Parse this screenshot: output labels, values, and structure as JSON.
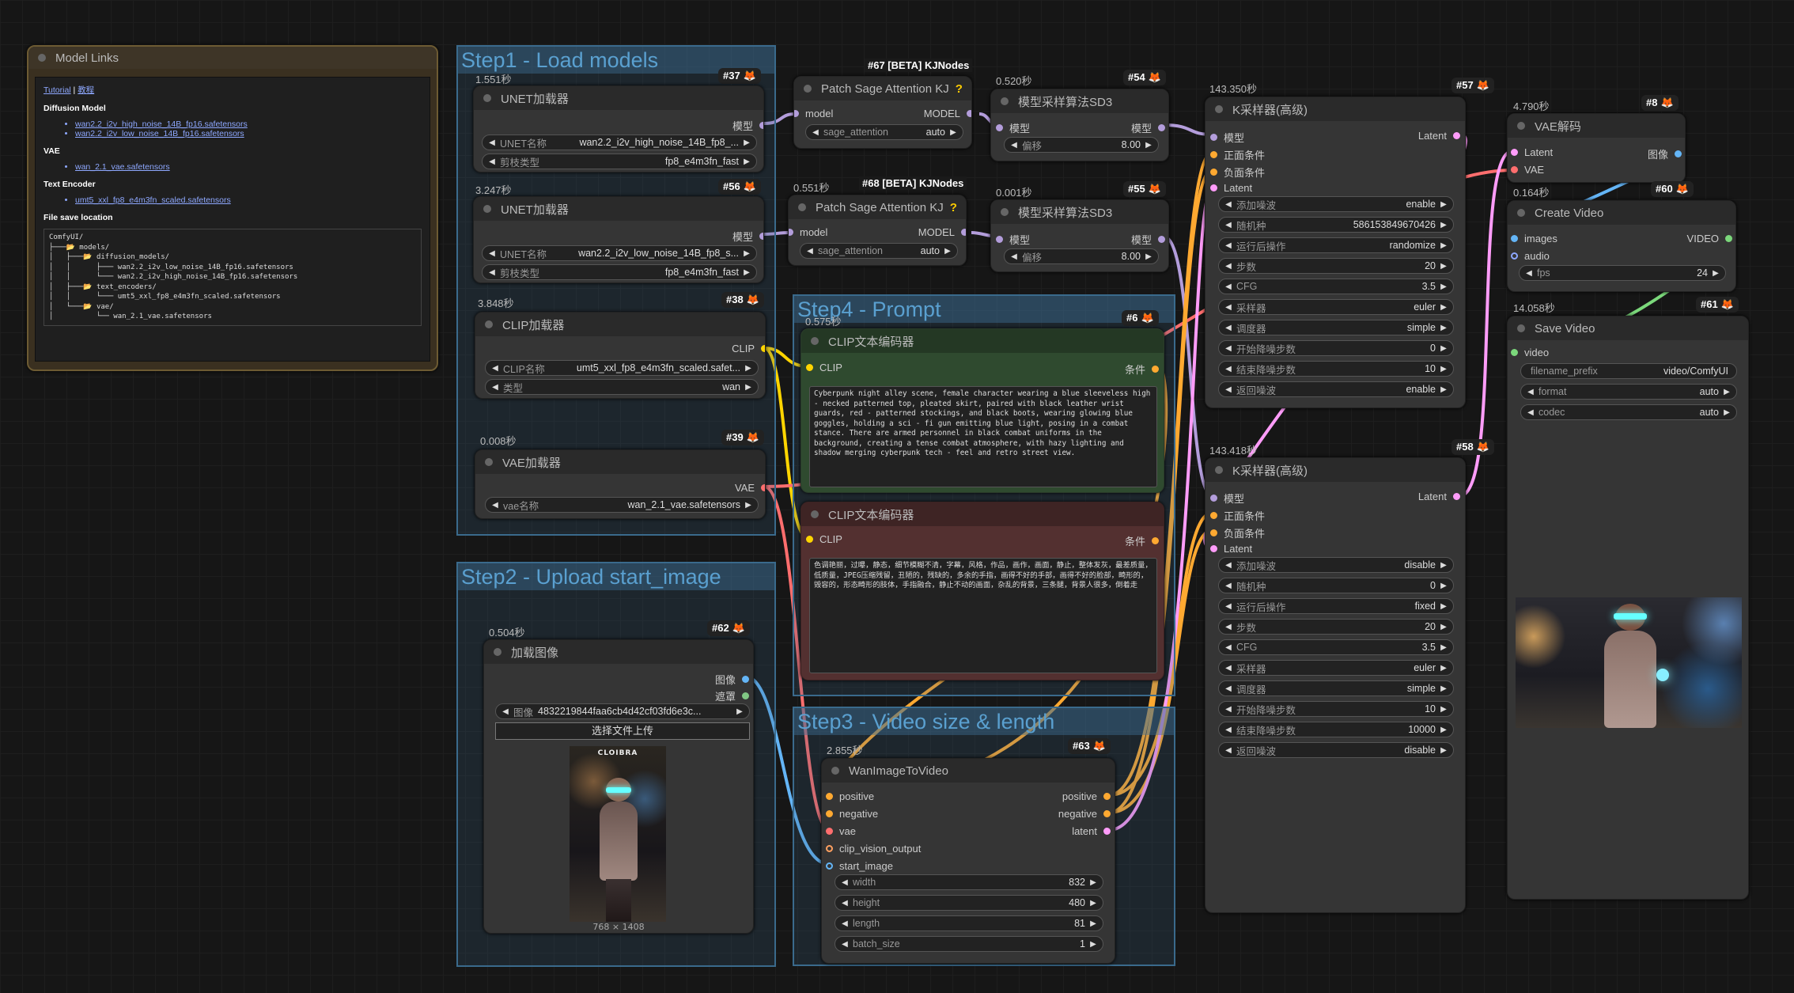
{
  "colors": {
    "model": "#b39ddb",
    "clip": "#ffd500",
    "vae": "#ff6e6e",
    "latent": "#ff9cf9",
    "image": "#64b5f6",
    "mask": "#81c784",
    "cond": "#ffa931",
    "video": "#7bd87b"
  },
  "model_links": {
    "title": "Model Links",
    "tutorial": "Tutorial",
    "sep": " | ",
    "jiaocheng": "教程",
    "diffusion_h": "Diffusion Model",
    "diffusion": [
      "wan2.2_i2v_high_noise_14B_fp16.safetensors",
      "wan2.2_i2v_low_noise_14B_fp16.safetensors"
    ],
    "vae_h": "VAE",
    "vae": [
      "wan_2.1_vae.safetensors"
    ],
    "te_h": "Text Encoder",
    "te": [
      "umt5_xxl_fp8_e4m3fn_scaled.safetensors"
    ],
    "fs_h": "File save location",
    "tree": "ComfyUI/\n├───📂 models/\n│   ├───📂 diffusion_models/\n│   │      ├─── wan2.2_i2v_low_noise_14B_fp16.safetensors\n│   │      └─── wan2.2_i2v_high_noise_14B_fp16.safetensors\n│   ├───📂 text_encoders/\n│   │      └─── umt5_xxl_fp8_e4m3fn_scaled.safetensors\n│   └───📂 vae/\n│          └── wan_2.1_vae.safetensors"
  },
  "groups": {
    "g1": "Step1 - Load models",
    "g2": "Step2 - Upload start_image",
    "g3": "Step3 - Video size & length",
    "g4": "Step4 -  Prompt"
  },
  "n37": {
    "time": "1.551秒",
    "id": "#37",
    "title": "UNET加载器",
    "out": "模型",
    "w1l": "UNET名称",
    "w1v": "wan2.2_i2v_high_noise_14B_fp8_...",
    "w2l": "剪枝类型",
    "w2v": "fp8_e4m3fn_fast"
  },
  "n56": {
    "time": "3.247秒",
    "id": "#56",
    "title": "UNET加载器",
    "out": "模型",
    "w1l": "UNET名称",
    "w1v": "wan2.2_i2v_low_noise_14B_fp8_s...",
    "w2l": "剪枝类型",
    "w2v": "fp8_e4m3fn_fast"
  },
  "n38": {
    "time": "3.848秒",
    "id": "#38",
    "title": "CLIP加载器",
    "out": "CLIP",
    "w1l": "CLIP名称",
    "w1v": "umt5_xxl_fp8_e4m3fn_scaled.safet...",
    "w2l": "类型",
    "w2v": "wan"
  },
  "n39": {
    "time": "0.008秒",
    "id": "#39",
    "title": "VAE加载器",
    "out": "VAE",
    "w1l": "vae名称",
    "w1v": "wan_2.1_vae.safetensors"
  },
  "n67": {
    "ext": "#67 [BETA] KJNodes",
    "title": "Patch Sage Attention KJ",
    "q": "?",
    "in": "model",
    "out": "MODEL",
    "wl": "sage_attention",
    "wv": "auto"
  },
  "n68": {
    "time": "0.551秒",
    "ext": "#68 [BETA] KJNodes",
    "title": "Patch Sage Attention KJ",
    "q": "?",
    "in": "model",
    "out": "MODEL",
    "wl": "sage_attention",
    "wv": "auto"
  },
  "n54": {
    "time": "0.520秒",
    "id": "#54",
    "title": "模型采样算法SD3",
    "in": "模型",
    "out": "模型",
    "wl": "偏移",
    "wv": "8.00"
  },
  "n55": {
    "time": "0.001秒",
    "id": "#55",
    "title": "模型采样算法SD3",
    "in": "模型",
    "out": "模型",
    "wl": "偏移",
    "wv": "8.00"
  },
  "n6": {
    "time": "0.575秒",
    "id": "#6",
    "title": "CLIP文本编码器",
    "in": "CLIP",
    "out": "条件",
    "text": "Cyberpunk night alley scene, female character wearing a blue sleeveless high - necked patterned top, pleated skirt, paired with black leather wrist guards, red - patterned stockings, and black boots, wearing glowing blue goggles, holding a sci - fi gun emitting blue light, posing in a combat stance. There are armed personnel in black combat uniforms in the background, creating a tense combat atmosphere, with hazy lighting and shadow merging cyberpunk tech - feel and retro street view."
  },
  "n7": {
    "title": "CLIP文本编码器",
    "in": "CLIP",
    "out": "条件",
    "text": "色调艳丽，过曝，静态，细节模糊不清，字幕，风格，作品，画作，画面，静止，整体发灰，最差质量，低质量，JPEG压缩残留，丑陋的，残缺的，多余的手指，画得不好的手部，画得不好的脸部，畸形的，毁容的，形态畸形的肢体，手指融合，静止不动的画面，杂乱的背景，三条腿，背景人很多，倒着走"
  },
  "n62": {
    "time": "0.504秒",
    "id": "#62",
    "title": "加载图像",
    "out1": "图像",
    "out2": "遮罩",
    "wl": "图像",
    "wv": "4832219844faa6cb4d42cf03fd6e3c...",
    "upload": "选择文件上传",
    "dims": "768 × 1408",
    "brand": "CLOIBRA"
  },
  "n63": {
    "time": "2.855秒",
    "id": "#63",
    "title": "WanImageToVideo",
    "ins": [
      "positive",
      "negative",
      "vae",
      "clip_vision_output",
      "start_image"
    ],
    "outs": [
      "positive",
      "negative",
      "latent"
    ],
    "widgets": [
      {
        "l": "width",
        "v": "832"
      },
      {
        "l": "height",
        "v": "480"
      },
      {
        "l": "length",
        "v": "81"
      },
      {
        "l": "batch_size",
        "v": "1"
      }
    ]
  },
  "n57": {
    "time": "143.350秒",
    "id": "#57",
    "title": "K采样器(高级)",
    "ins": [
      "模型",
      "正面条件",
      "负面条件",
      "Latent"
    ],
    "out": "Latent",
    "widgets": [
      {
        "l": "添加噪波",
        "v": "enable"
      },
      {
        "l": "随机种",
        "v": "586153849670426"
      },
      {
        "l": "运行后操作",
        "v": "randomize"
      },
      {
        "l": "步数",
        "v": "20"
      },
      {
        "l": "CFG",
        "v": "3.5"
      },
      {
        "l": "采样器",
        "v": "euler"
      },
      {
        "l": "调度器",
        "v": "simple"
      },
      {
        "l": "开始降噪步数",
        "v": "0"
      },
      {
        "l": "结束降噪步数",
        "v": "10"
      },
      {
        "l": "返回噪波",
        "v": "enable"
      }
    ]
  },
  "n58": {
    "time": "143.418秒",
    "id": "#58",
    "title": "K采样器(高级)",
    "ins": [
      "模型",
      "正面条件",
      "负面条件",
      "Latent"
    ],
    "out": "Latent",
    "widgets": [
      {
        "l": "添加噪波",
        "v": "disable"
      },
      {
        "l": "随机种",
        "v": "0"
      },
      {
        "l": "运行后操作",
        "v": "fixed"
      },
      {
        "l": "步数",
        "v": "20"
      },
      {
        "l": "CFG",
        "v": "3.5"
      },
      {
        "l": "采样器",
        "v": "euler"
      },
      {
        "l": "调度器",
        "v": "simple"
      },
      {
        "l": "开始降噪步数",
        "v": "10"
      },
      {
        "l": "结束降噪步数",
        "v": "10000"
      },
      {
        "l": "返回噪波",
        "v": "disable"
      }
    ]
  },
  "n8": {
    "time": "4.790秒",
    "id": "#8",
    "title": "VAE解码",
    "ins": [
      "Latent",
      "VAE"
    ],
    "out": "图像"
  },
  "n60": {
    "time": "0.164秒",
    "id": "#60",
    "title": "Create Video",
    "ins": [
      "images",
      "audio"
    ],
    "out": "VIDEO",
    "wl": "fps",
    "wv": "24"
  },
  "n61": {
    "time": "14.058秒",
    "id": "#61",
    "title": "Save Video",
    "in": "video",
    "widgets": [
      {
        "l": "filename_prefix",
        "v": "video/ComfyUI"
      },
      {
        "l": "format",
        "v": "auto"
      },
      {
        "l": "codec",
        "v": "auto"
      }
    ]
  }
}
